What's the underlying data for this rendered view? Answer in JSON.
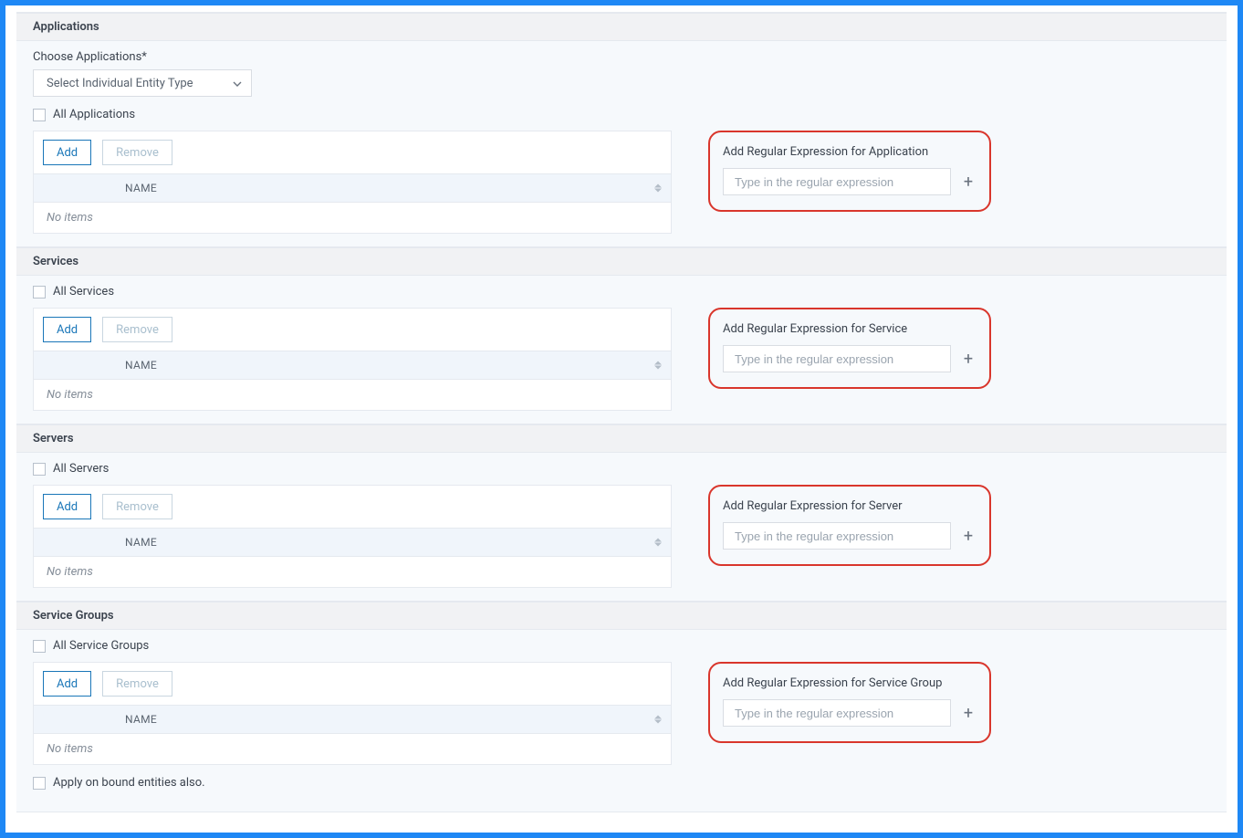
{
  "sections": {
    "applications": {
      "title": "Applications",
      "chooseLabel": "Choose Applications*",
      "dropdown": "Select Individual Entity Type",
      "allLabel": "All Applications",
      "addBtn": "Add",
      "removeBtn": "Remove",
      "nameHeader": "NAME",
      "emptyMsg": "No items",
      "regexLabel": "Add Regular Expression for Application",
      "regexPlaceholder": "Type in the regular expression"
    },
    "services": {
      "title": "Services",
      "allLabel": "All Services",
      "addBtn": "Add",
      "removeBtn": "Remove",
      "nameHeader": "NAME",
      "emptyMsg": "No items",
      "regexLabel": "Add Regular Expression for Service",
      "regexPlaceholder": "Type in the regular expression"
    },
    "servers": {
      "title": "Servers",
      "allLabel": "All Servers",
      "addBtn": "Add",
      "removeBtn": "Remove",
      "nameHeader": "NAME",
      "emptyMsg": "No items",
      "regexLabel": "Add Regular Expression for Server",
      "regexPlaceholder": "Type in the regular expression"
    },
    "serviceGroups": {
      "title": "Service Groups",
      "allLabel": "All Service Groups",
      "addBtn": "Add",
      "removeBtn": "Remove",
      "nameHeader": "NAME",
      "emptyMsg": "No items",
      "regexLabel": "Add Regular Expression for Service Group",
      "regexPlaceholder": "Type in the regular expression",
      "applyBound": "Apply on bound entities also."
    }
  }
}
